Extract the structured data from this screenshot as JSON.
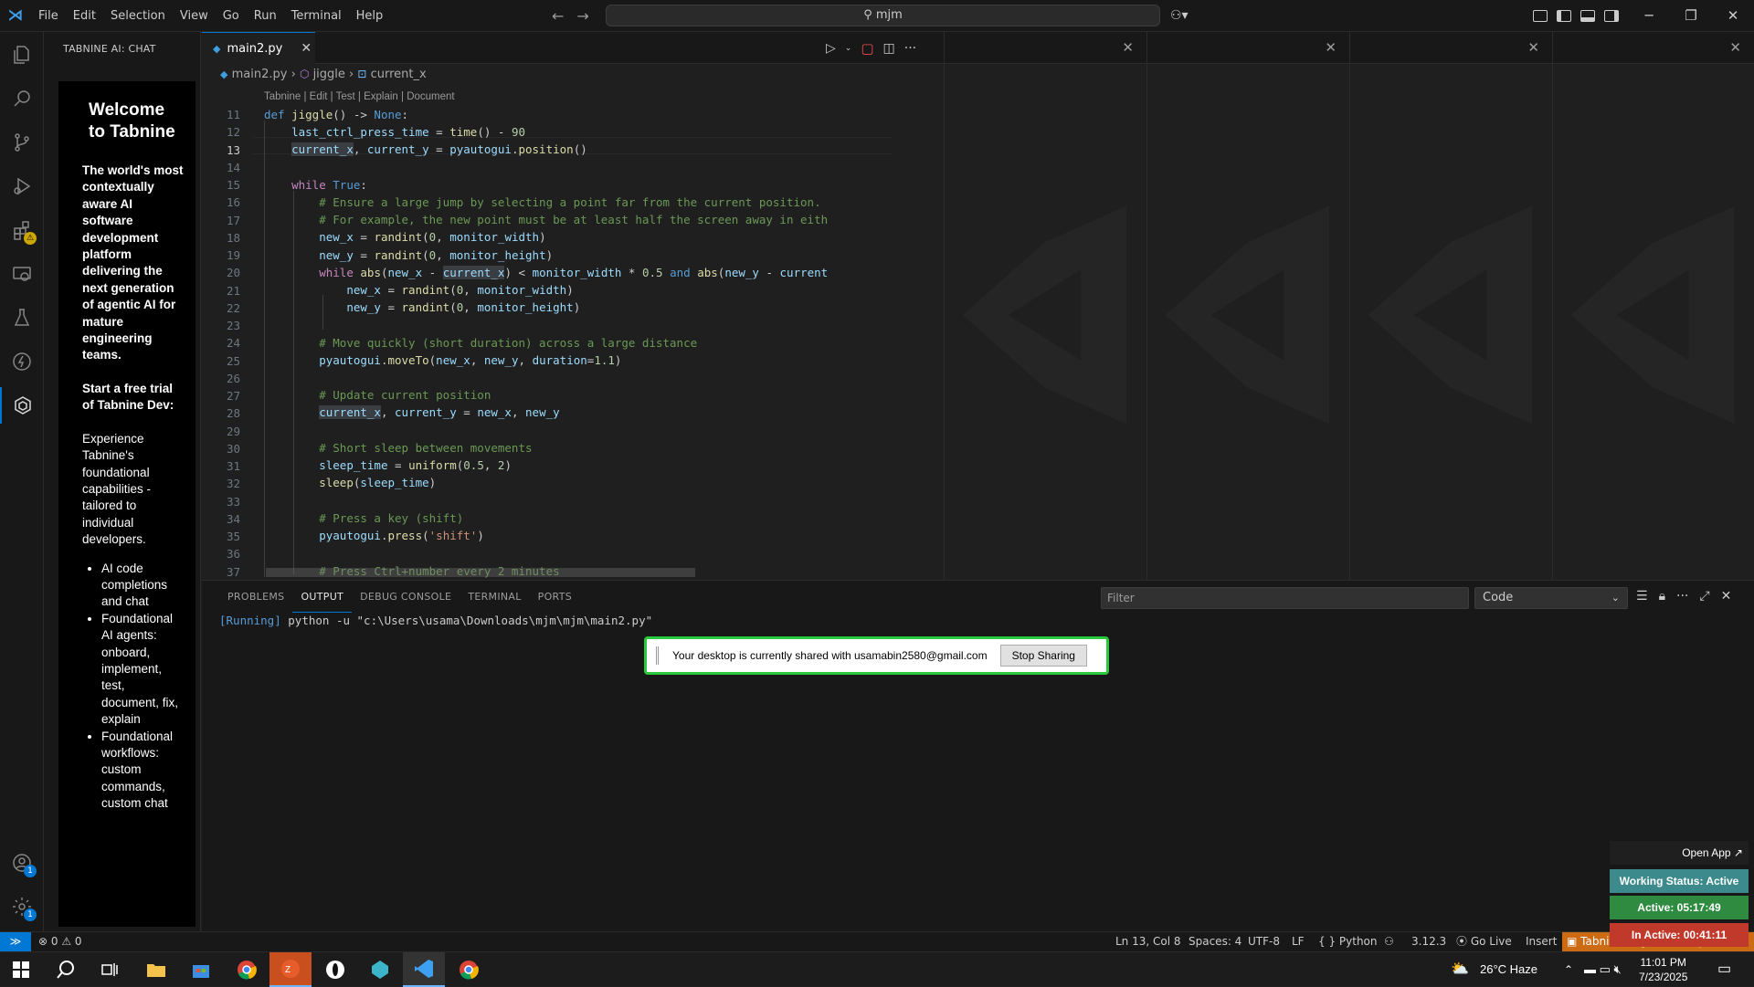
{
  "titlebar": {
    "menu": [
      "File",
      "Edit",
      "Selection",
      "View",
      "Go",
      "Run",
      "Terminal",
      "Help"
    ],
    "search": "mjm"
  },
  "sidebar": {
    "title": "TABNINE AI: CHAT",
    "welcome": "Welcome to Tabnine",
    "tagline": "The world's most contextually aware AI software development platform delivering the next generation of agentic AI for mature engineering teams.",
    "trial": "Start a free trial of Tabnine Dev:",
    "description": "Experience Tabnine's foundational capabilities - tailored to individual developers.",
    "features": [
      "AI code completions and chat",
      "Foundational AI agents: onboard, implement, test, document, fix, explain",
      "Foundational workflows: custom commands, custom chat"
    ]
  },
  "activity_badges": {
    "extensions": "⚠",
    "accounts": "1",
    "manage": "1"
  },
  "editor": {
    "tab_label": "main2.py",
    "breadcrumb": [
      "main2.py",
      "jiggle",
      "current_x"
    ],
    "codelens": "Tabnine | Edit | Test | Explain | Document",
    "line_numbers": [
      "11",
      "12",
      "13",
      "14",
      "15",
      "16",
      "17",
      "18",
      "19",
      "20",
      "21",
      "22",
      "23",
      "24",
      "25",
      "26",
      "27",
      "28",
      "29",
      "30",
      "31",
      "32",
      "33",
      "34",
      "35",
      "36",
      "37"
    ],
    "active_line": "13"
  },
  "panel": {
    "tabs": [
      "PROBLEMS",
      "OUTPUT",
      "DEBUG CONSOLE",
      "TERMINAL",
      "PORTS"
    ],
    "active_tab": "OUTPUT",
    "filter_placeholder": "Filter",
    "channel": "Code",
    "output_run": "[Running]",
    "output_cmd": "python -u \"c:\\Users\\usama\\Downloads\\mjm\\mjm\\main2.py\""
  },
  "share_bar": {
    "text": "Your desktop is currently shared with usamabin2580@gmail.com",
    "button": "Stop Sharing"
  },
  "tracker": {
    "open_app": "Open App ↗",
    "working_status": "Working Status: Active",
    "active": "Active: 05:17:49",
    "inactive": "In Active: 00:41:11",
    "colors": {
      "working": "#3c8a8c",
      "active": "#2e8b3f",
      "inactive": "#c0392b"
    }
  },
  "statusbar": {
    "errors": "0",
    "warnings": "0",
    "position": "Ln 13, Col 8",
    "spaces": "Spaces: 4",
    "encoding": "UTF-8",
    "eol": "LF",
    "language": "Python",
    "version": "3.12.3",
    "golive": "Go Live",
    "mode": "Insert",
    "tabnine": "Tabnine: Sign-in is required"
  },
  "taskbar": {
    "weather": "26°C  Haze",
    "time": "11:01 PM",
    "date": "7/23/2025"
  }
}
